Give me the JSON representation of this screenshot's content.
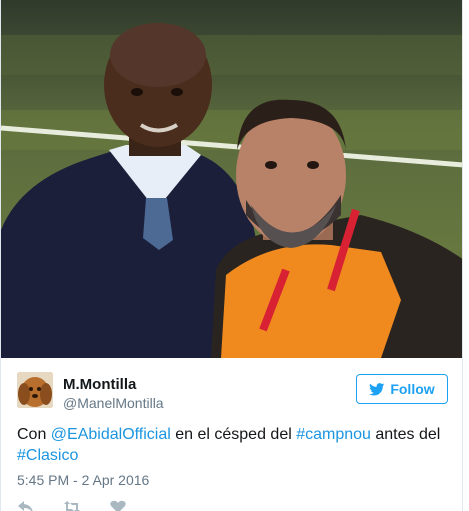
{
  "author": {
    "name": "M.Montilla",
    "handle": "@ManelMontilla",
    "avatar_icon": "dog-avatar-icon"
  },
  "follow_button": {
    "label": "Follow",
    "icon": "twitter-bird-icon",
    "color": "#1da1f2"
  },
  "tweet": {
    "parts": [
      {
        "text": "Con ",
        "type": "plain"
      },
      {
        "text": "@EAbidalOfficial",
        "type": "mention"
      },
      {
        "text": " en el césped del ",
        "type": "plain"
      },
      {
        "text": "#campnou",
        "type": "hashtag"
      },
      {
        "text": " antes del ",
        "type": "plain"
      },
      {
        "text": "#Clasico",
        "type": "hashtag"
      }
    ],
    "link_color": "#1b95e0"
  },
  "timestamp": "5:45 PM - 2 Apr 2016",
  "actions": [
    "reply-icon",
    "retweet-icon",
    "like-icon"
  ]
}
